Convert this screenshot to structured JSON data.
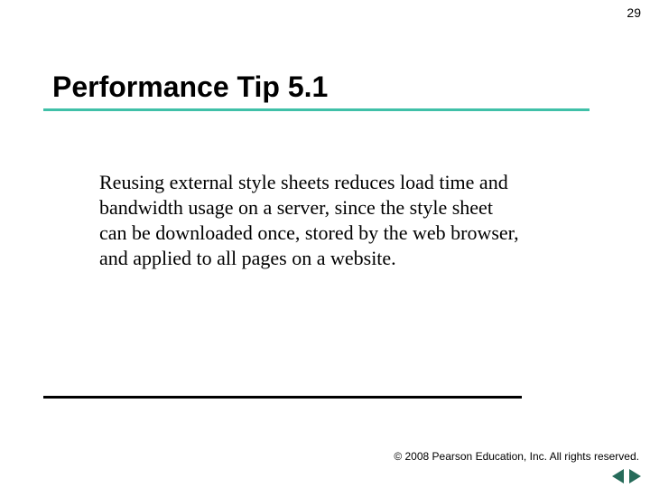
{
  "page_number": "29",
  "title": "Performance Tip 5.1",
  "body": "Reusing external style sheets reduces load time and bandwidth usage on a server, since the style sheet can be downloaded once, stored by the web browser, and applied to all pages on a website.",
  "copyright": "© 2008 Pearson Education, Inc.  All rights reserved.",
  "icons": {
    "prev": "triangle-left-icon",
    "next": "triangle-right-icon"
  },
  "colors": {
    "rule_accent": "#40c0a8",
    "arrow": "#266b5a"
  }
}
